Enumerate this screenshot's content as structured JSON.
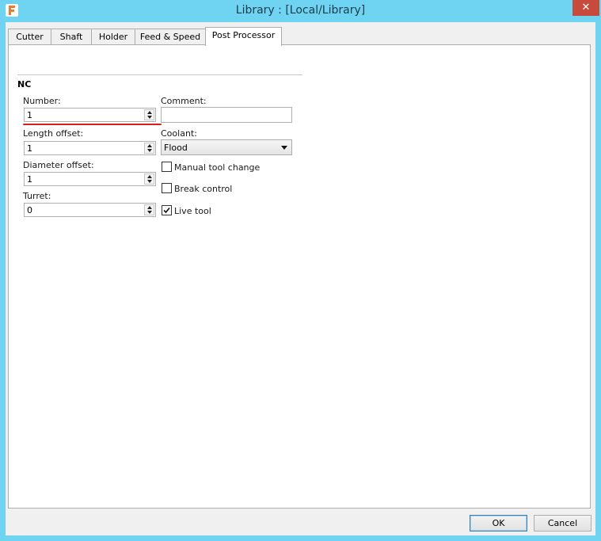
{
  "window": {
    "title": "Library :  [Local/Library]",
    "close_glyph": "✕",
    "app_icon": "fusion-logo-icon",
    "accent_color": "#6fd3f2",
    "close_color": "#c74a3c"
  },
  "tabs": [
    {
      "label": "Cutter",
      "active": false
    },
    {
      "label": "Shaft",
      "active": false
    },
    {
      "label": "Holder",
      "active": false
    },
    {
      "label": "Feed & Speed",
      "active": false
    },
    {
      "label": "Post Processor",
      "active": true
    }
  ],
  "nc": {
    "section_title": "NC",
    "number": {
      "label": "Number:",
      "value": "1"
    },
    "length_offset": {
      "label": "Length offset:",
      "value": "1"
    },
    "diameter_offset": {
      "label": "Diameter offset:",
      "value": "1"
    },
    "turret": {
      "label": "Turret:",
      "value": "0"
    },
    "comment": {
      "label": "Comment:",
      "value": ""
    },
    "coolant": {
      "label": "Coolant:",
      "value": "Flood"
    },
    "manual_tool_change": {
      "label": "Manual tool change",
      "checked": false
    },
    "break_control": {
      "label": "Break control",
      "checked": false
    },
    "live_tool": {
      "label": "Live tool",
      "checked": true
    }
  },
  "buttons": {
    "ok": "OK",
    "cancel": "Cancel"
  }
}
